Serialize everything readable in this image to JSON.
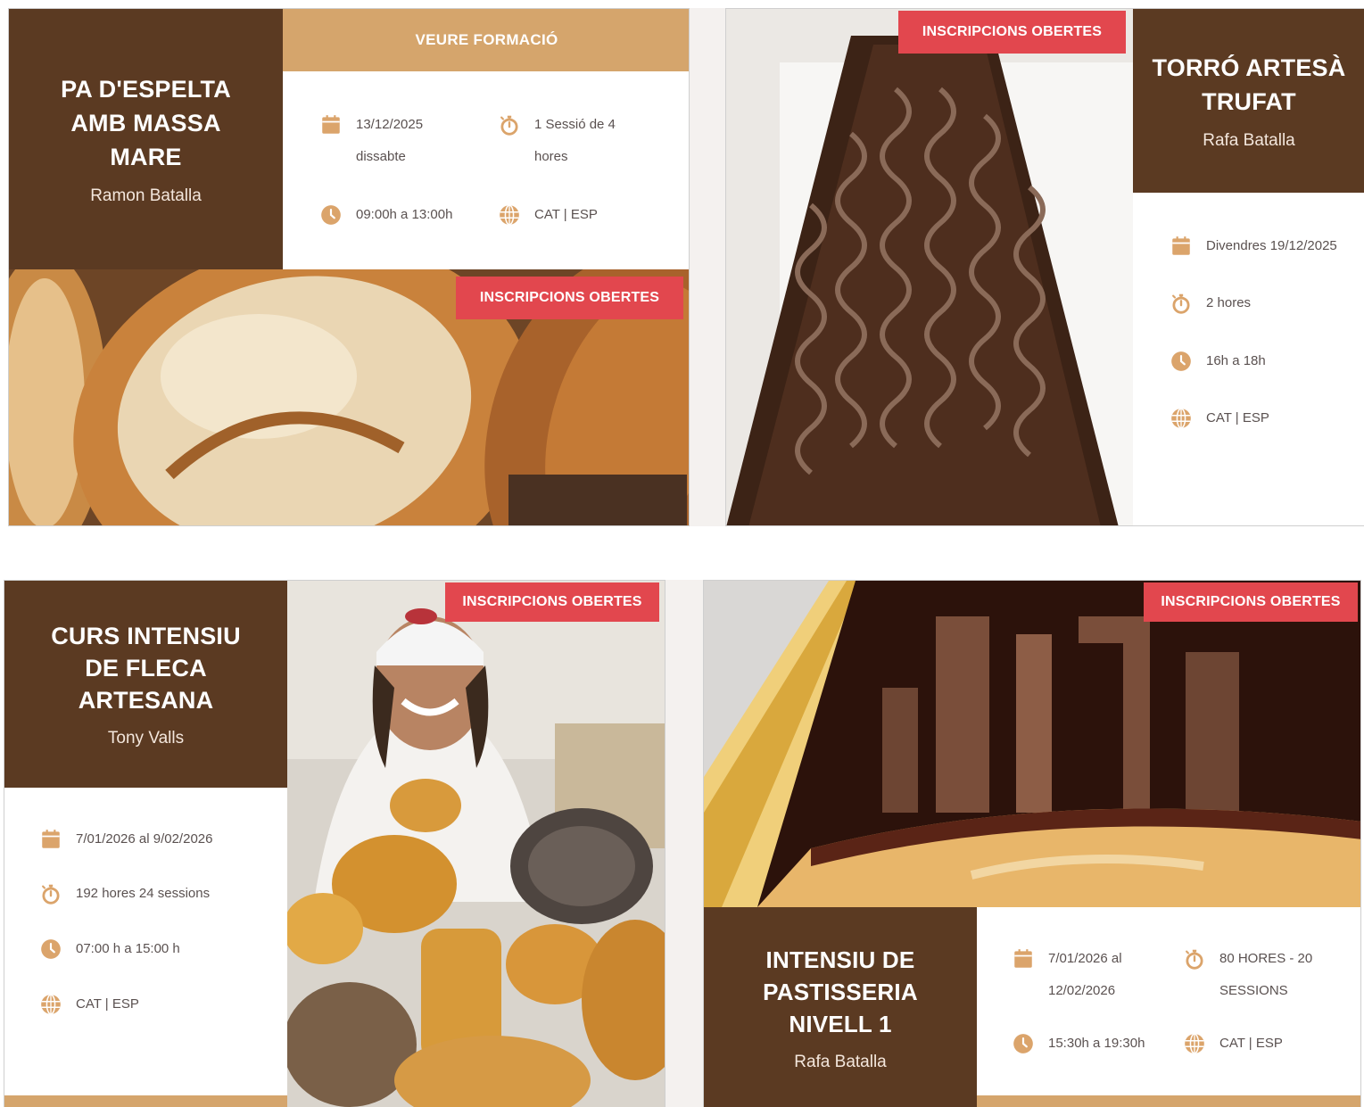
{
  "badge_label": "INSCRIPCIONS OBERTES",
  "colors": {
    "brown": "#5b3a22",
    "accent": "#d5a56c",
    "badge": "#e2474e",
    "icon": "#dba46b"
  },
  "cards": {
    "espelta": {
      "title_lines": [
        "PA D'ESPELTA",
        "AMB MASSA",
        "MARE"
      ],
      "teacher": "Ramon Batalla",
      "button": "VEURE FORMACIÓ",
      "date_line1": "13/12/2025",
      "date_line2": "dissabte",
      "duration_line1": "1 Sessió de 4",
      "duration_line2": "hores",
      "schedule": "09:00h a 13:00h",
      "language": "CAT | ESP",
      "image": "artisan bread loaves"
    },
    "torro": {
      "title_lines": [
        "TORRÓ ARTESÀ",
        "TRUFAT"
      ],
      "teacher": "Rafa Batalla",
      "date": "Divendres 19/12/2025",
      "duration": "2 hores",
      "schedule": "16h a 18h",
      "language": "CAT | ESP",
      "image": "chocolate truffled nougat bar"
    },
    "fleca": {
      "title_lines": [
        "CURS INTENSIU",
        "DE FLECA",
        "ARTESANA"
      ],
      "teacher": "Tony Valls",
      "date": "7/01/2026 al 9/02/2026",
      "duration": "192 hores 24 sessions",
      "schedule": "07:00 h a 15:00 h",
      "language": "CAT | ESP",
      "image": "smiling baker with breads"
    },
    "pastisseria": {
      "title_lines": [
        "INTENSIU DE",
        "PASTISSERIA",
        "NIVELL 1"
      ],
      "teacher": "Rafa Batalla",
      "date_line1": "7/01/2026 al",
      "date_line2": "12/02/2026",
      "duration_line1": "80 HORES - 20",
      "duration_line2": "SESSIONS",
      "schedule": "15:30h a 19:30h",
      "language": "CAT | ESP",
      "image": "glazed chocolate roll cake"
    }
  }
}
